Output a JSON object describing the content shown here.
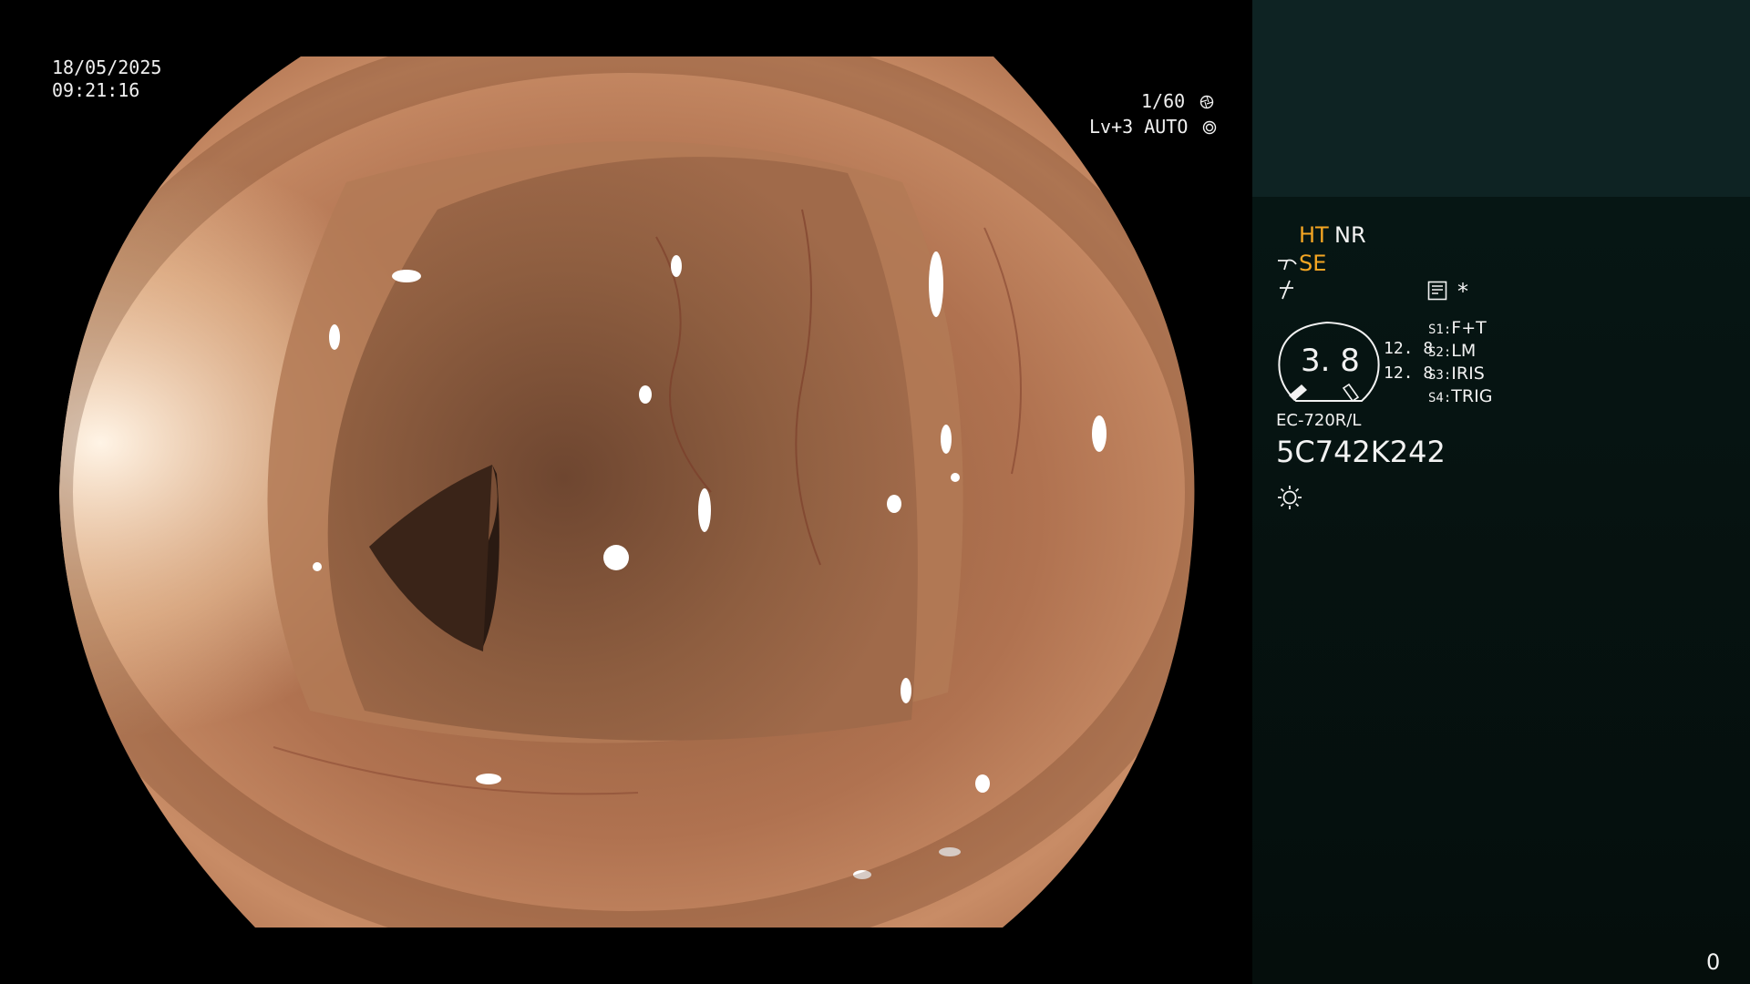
{
  "overlay": {
    "date": "18/05/2025",
    "time": "09:21:16",
    "shutter": "1/60",
    "level": "Lv+3 AUTO"
  },
  "panel": {
    "ht": "HT",
    "nr": "NR",
    "se": "SE",
    "asterisk": "*",
    "gauge_value": "3. 8",
    "value_1": "12. 8",
    "value_2": "12. 8",
    "switches": [
      {
        "key": "S1:",
        "value": "F+T"
      },
      {
        "key": "S2:",
        "value": "LM"
      },
      {
        "key": "S3:",
        "value": "IRIS"
      },
      {
        "key": "S4:",
        "value": "TRIG"
      }
    ],
    "model": "EC-720R/L",
    "serial": "5C742K242",
    "counter": "0"
  },
  "icons": {
    "shutter": "shutter-icon",
    "auto": "auto-iris-icon",
    "hook": "hook-icon",
    "slash": "structure-enhance-icon",
    "memo": "memo-icon",
    "sun": "brightness-icon"
  },
  "colors": {
    "accent_orange": "#f5a623",
    "panel_top": "#0e2323",
    "panel_bottom": "#061614"
  }
}
